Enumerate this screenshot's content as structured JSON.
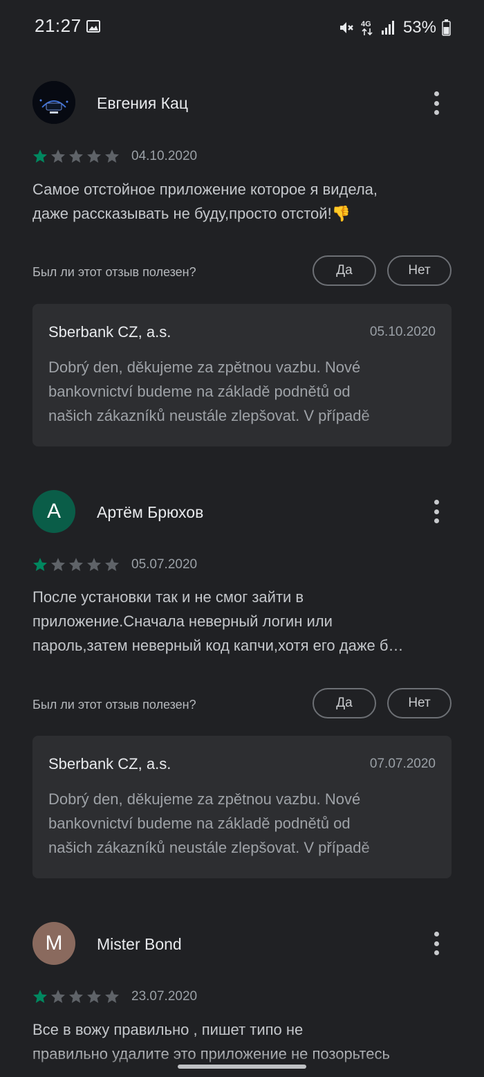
{
  "status_bar": {
    "time": "21:27",
    "network": "4G",
    "battery_percent": "53%",
    "icons": [
      "gallery-icon",
      "mute-icon",
      "signal-icon",
      "battery-icon"
    ]
  },
  "reviews": [
    {
      "author": "Евгения Кац",
      "avatar_letter": "",
      "rating": 1,
      "date": "04.10.2020",
      "text_lines": [
        "Самое отстойное приложение которое я видела,",
        "даже рассказывать не буду,просто отстой!👎"
      ],
      "helpful_question": "Был ли этот отзыв полезен?",
      "yes_label": "Да",
      "no_label": "Нет",
      "reply": {
        "developer": "Sberbank CZ, a.s.",
        "date": "05.10.2020",
        "text_lines": [
          "Dobrý den, děkujeme za zpětnou vazbu. Nové",
          "bankovnictví budeme na základě podnětů od",
          "našich zákazníků neustále zlepšovat. V případě"
        ]
      }
    },
    {
      "author": "Артём Брюхов",
      "avatar_letter": "A",
      "rating": 1,
      "date": "05.07.2020",
      "text_lines": [
        "После установки так и не смог зайти в",
        "приложение.Сначала неверный логин или",
        "пароль,затем неверный код капчи,хотя его даже б…"
      ],
      "helpful_question": "Был ли этот отзыв полезен?",
      "yes_label": "Да",
      "no_label": "Нет",
      "reply": {
        "developer": "Sberbank CZ, a.s.",
        "date": "07.07.2020",
        "text_lines": [
          "Dobrý den, děkujeme za zpětnou vazbu. Nové",
          "bankovnictví budeme na základě podnětů od",
          "našich zákazníků neustále zlepšovat. V případě"
        ]
      }
    },
    {
      "author": "Mister Bond",
      "avatar_letter": "M",
      "rating": 1,
      "date": "23.07.2020",
      "text_lines": [
        "Все в вожу правильно , пишет типо не",
        "правильно удалите это приложение не позорьтесь"
      ]
    }
  ],
  "colors": {
    "background": "#202124",
    "star_filled": "#01875f",
    "star_empty": "#5f6368",
    "avatar_artem": "#0a5d48",
    "avatar_mister": "#8a6a5e"
  }
}
